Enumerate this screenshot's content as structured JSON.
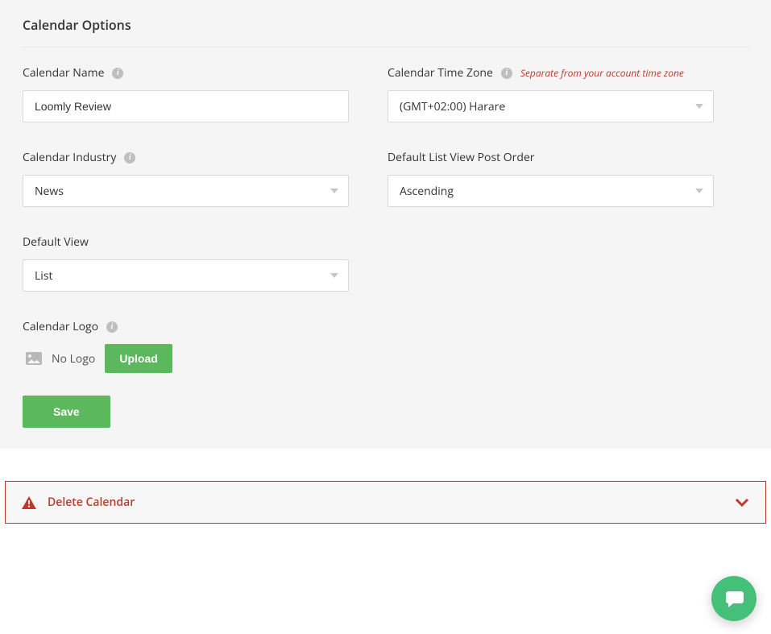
{
  "panel": {
    "title": "Calendar Options",
    "fields": {
      "calendar_name": {
        "label": "Calendar Name",
        "value": "Loomly Review"
      },
      "time_zone": {
        "label": "Calendar Time Zone",
        "hint": "Separate from your account time zone",
        "value": "(GMT+02:00) Harare"
      },
      "industry": {
        "label": "Calendar Industry",
        "value": "News"
      },
      "post_order": {
        "label": "Default List View Post Order",
        "value": "Ascending"
      },
      "default_view": {
        "label": "Default View",
        "value": "List"
      },
      "logo": {
        "label": "Calendar Logo",
        "status": "No Logo",
        "upload_label": "Upload"
      }
    },
    "save_label": "Save"
  },
  "danger": {
    "label": "Delete Calendar"
  }
}
